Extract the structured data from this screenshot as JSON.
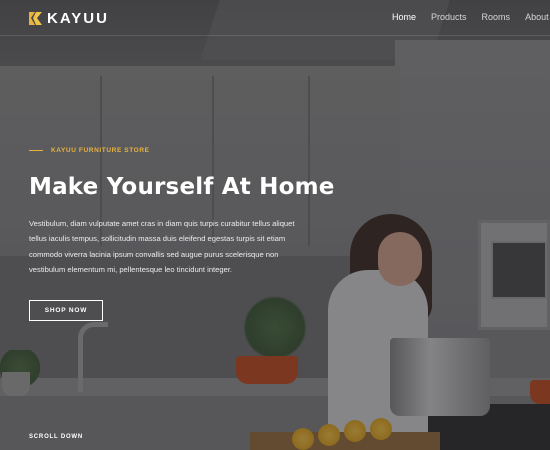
{
  "header": {
    "brand": "KAYUU",
    "logo_icon": "kayuu-logo-icon",
    "nav": [
      {
        "label": "Home",
        "active": true
      },
      {
        "label": "Products",
        "active": false
      },
      {
        "label": "Rooms",
        "active": false
      },
      {
        "label": "About U",
        "active": false
      }
    ]
  },
  "hero": {
    "eyebrow": "KAYUU FURNITURE STORE",
    "headline": "Make Yourself At Home",
    "body_lines": [
      "Vestibulum, diam vulputate amet cras in diam quis turpis curabitur tellus aliquet",
      "tellus iaculis tempus, sollicitudin massa duis eleifend egestas turpis sit etiam",
      "commodo viverra lacinia ipsum convallis sed augue purus scelerisque non",
      "vestibulum elementum mi, pellentesque leo tincidunt integer."
    ],
    "cta_label": "SHOP NOW",
    "scroll_label": "SCROLL DOWN"
  },
  "colors": {
    "accent": "#e8b23e",
    "text": "#ffffff",
    "nav_inactive": "#d6d6d6"
  }
}
